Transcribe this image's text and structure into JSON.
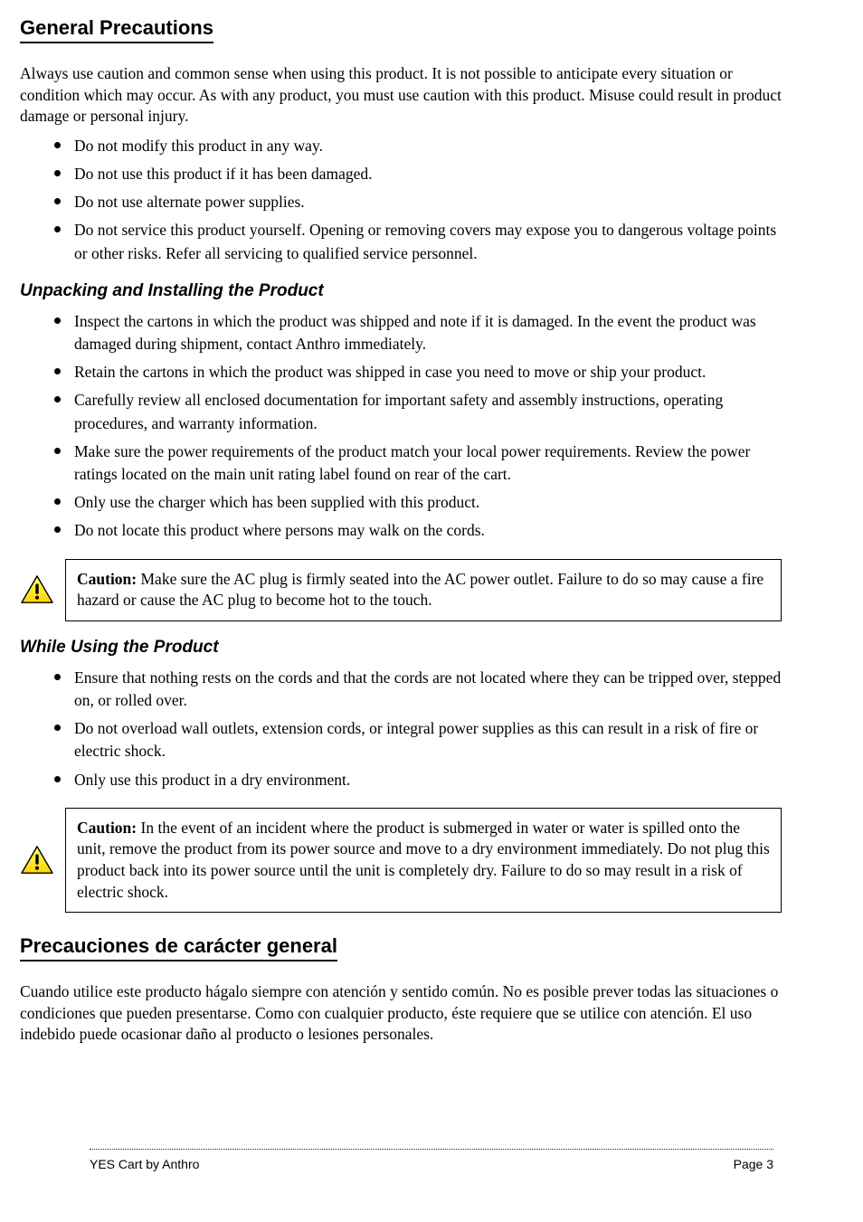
{
  "heading1": "General Precautions",
  "para1": "Always use caution and common sense when using this product. It is not possible to anticipate every situation or condition which may occur. As with any product, you must use caution with this product. Misuse could result in product damage or personal injury.",
  "list1": [
    "Do not modify this product in any way.",
    "Do not use this product if it has been damaged.",
    "Do not use alternate power supplies.",
    "Do not service this product yourself. Opening or removing covers may expose you to dangerous voltage points or other risks. Refer all servicing to qualified service personnel."
  ],
  "subhead1": "Unpacking and Installing the Product",
  "list2": [
    "Inspect the cartons in which the product was shipped and note if it is damaged. In the event the product was damaged during shipment, contact Anthro immediately.",
    "Retain the cartons in which the product was shipped in case you need to move or ship your product.",
    "Carefully review all enclosed documentation for important safety and assembly instructions, operating procedures, and warranty information.",
    "Make sure the power requirements of the product match your local power requirements. Review the power ratings located on the main unit rating label found on rear of the cart.",
    "Only use the charger which has been supplied with this product.",
    "Do not locate this product where persons may walk on the cords."
  ],
  "callout1_label": "Caution:",
  "callout1_text": " Make sure the AC plug is firmly seated into the AC power outlet. Failure to do so may cause a fire hazard or cause the AC plug to become hot to the touch.",
  "subhead2": "While Using the Product",
  "list3": [
    "Ensure that nothing rests on the cords and that the cords are not located where they can be tripped over, stepped on, or rolled over.",
    "Do not overload wall outlets, extension cords, or integral power supplies as this can result in a risk of fire or electric shock.",
    "Only use this product in a dry environment."
  ],
  "callout2_label": "Caution:",
  "callout2_text": " In the event of an incident where the product is submerged in water or water is spilled onto the unit, remove the product from its power source and move to a dry environment immediately. Do not plug this product back into its power source until the unit is completely dry. Failure to do so may result in a risk of electric shock.",
  "heading2": "Precauciones de carácter general",
  "para2": "Cuando utilice este producto hágalo siempre con atención y sentido común. No es posible prever todas las situaciones o condiciones que pueden presentarse. Como con cualquier producto, éste requiere que se utilice con atención. El uso indebido puede ocasionar daño al producto o lesiones personales.",
  "footer_left": "YES Cart by Anthro",
  "footer_right": "Page 3"
}
